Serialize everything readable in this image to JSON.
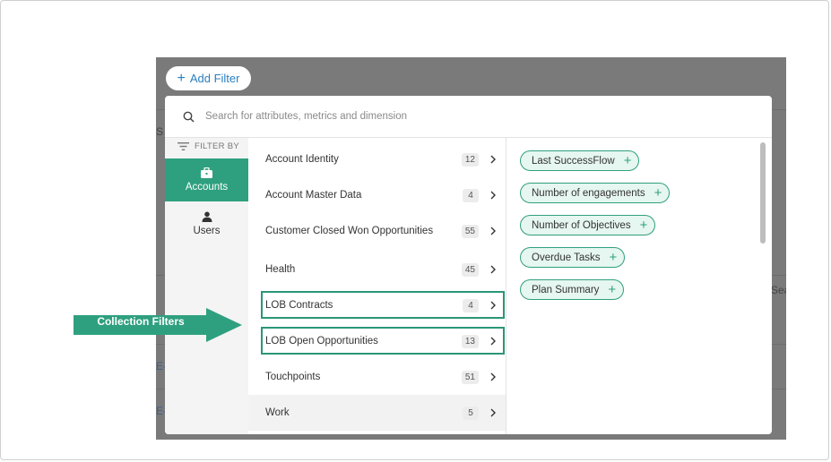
{
  "toolbar": {
    "add_filter_label": "Add Filter"
  },
  "search": {
    "placeholder": "Search for attributes, metrics and dimension"
  },
  "filter_by": {
    "label": "FILTER BY",
    "categories": [
      {
        "label": "Accounts",
        "icon": "briefcase-icon",
        "active": true
      },
      {
        "label": "Users",
        "icon": "user-icon",
        "active": false
      }
    ]
  },
  "groups": [
    {
      "label": "Account Identity",
      "count": "12"
    },
    {
      "label": "Account Master Data",
      "count": "4"
    },
    {
      "label": "Customer Closed Won Opportunities",
      "count": "55"
    },
    {
      "label": "Health",
      "count": "45"
    },
    {
      "label": "LOB Contracts",
      "count": "4"
    },
    {
      "label": "LOB Open Opportunities",
      "count": "13"
    },
    {
      "label": "Touchpoints",
      "count": "51"
    },
    {
      "label": "Work",
      "count": "5"
    }
  ],
  "fields": [
    {
      "label": "Last SuccessFlow"
    },
    {
      "label": "Number of engagements"
    },
    {
      "label": "Number of Objectives"
    },
    {
      "label": "Overdue Tasks"
    },
    {
      "label": "Plan Summary"
    }
  ],
  "annotation": {
    "label": "Collection Filters"
  },
  "background": {
    "fragment_1": "S",
    "fragment_2": "Sea",
    "fragment_3": "E-",
    "fragment_4": "E-"
  },
  "colors": {
    "accent": "#2fa07f",
    "link": "#2a7fc1",
    "overlay": "#7a7a7a"
  }
}
